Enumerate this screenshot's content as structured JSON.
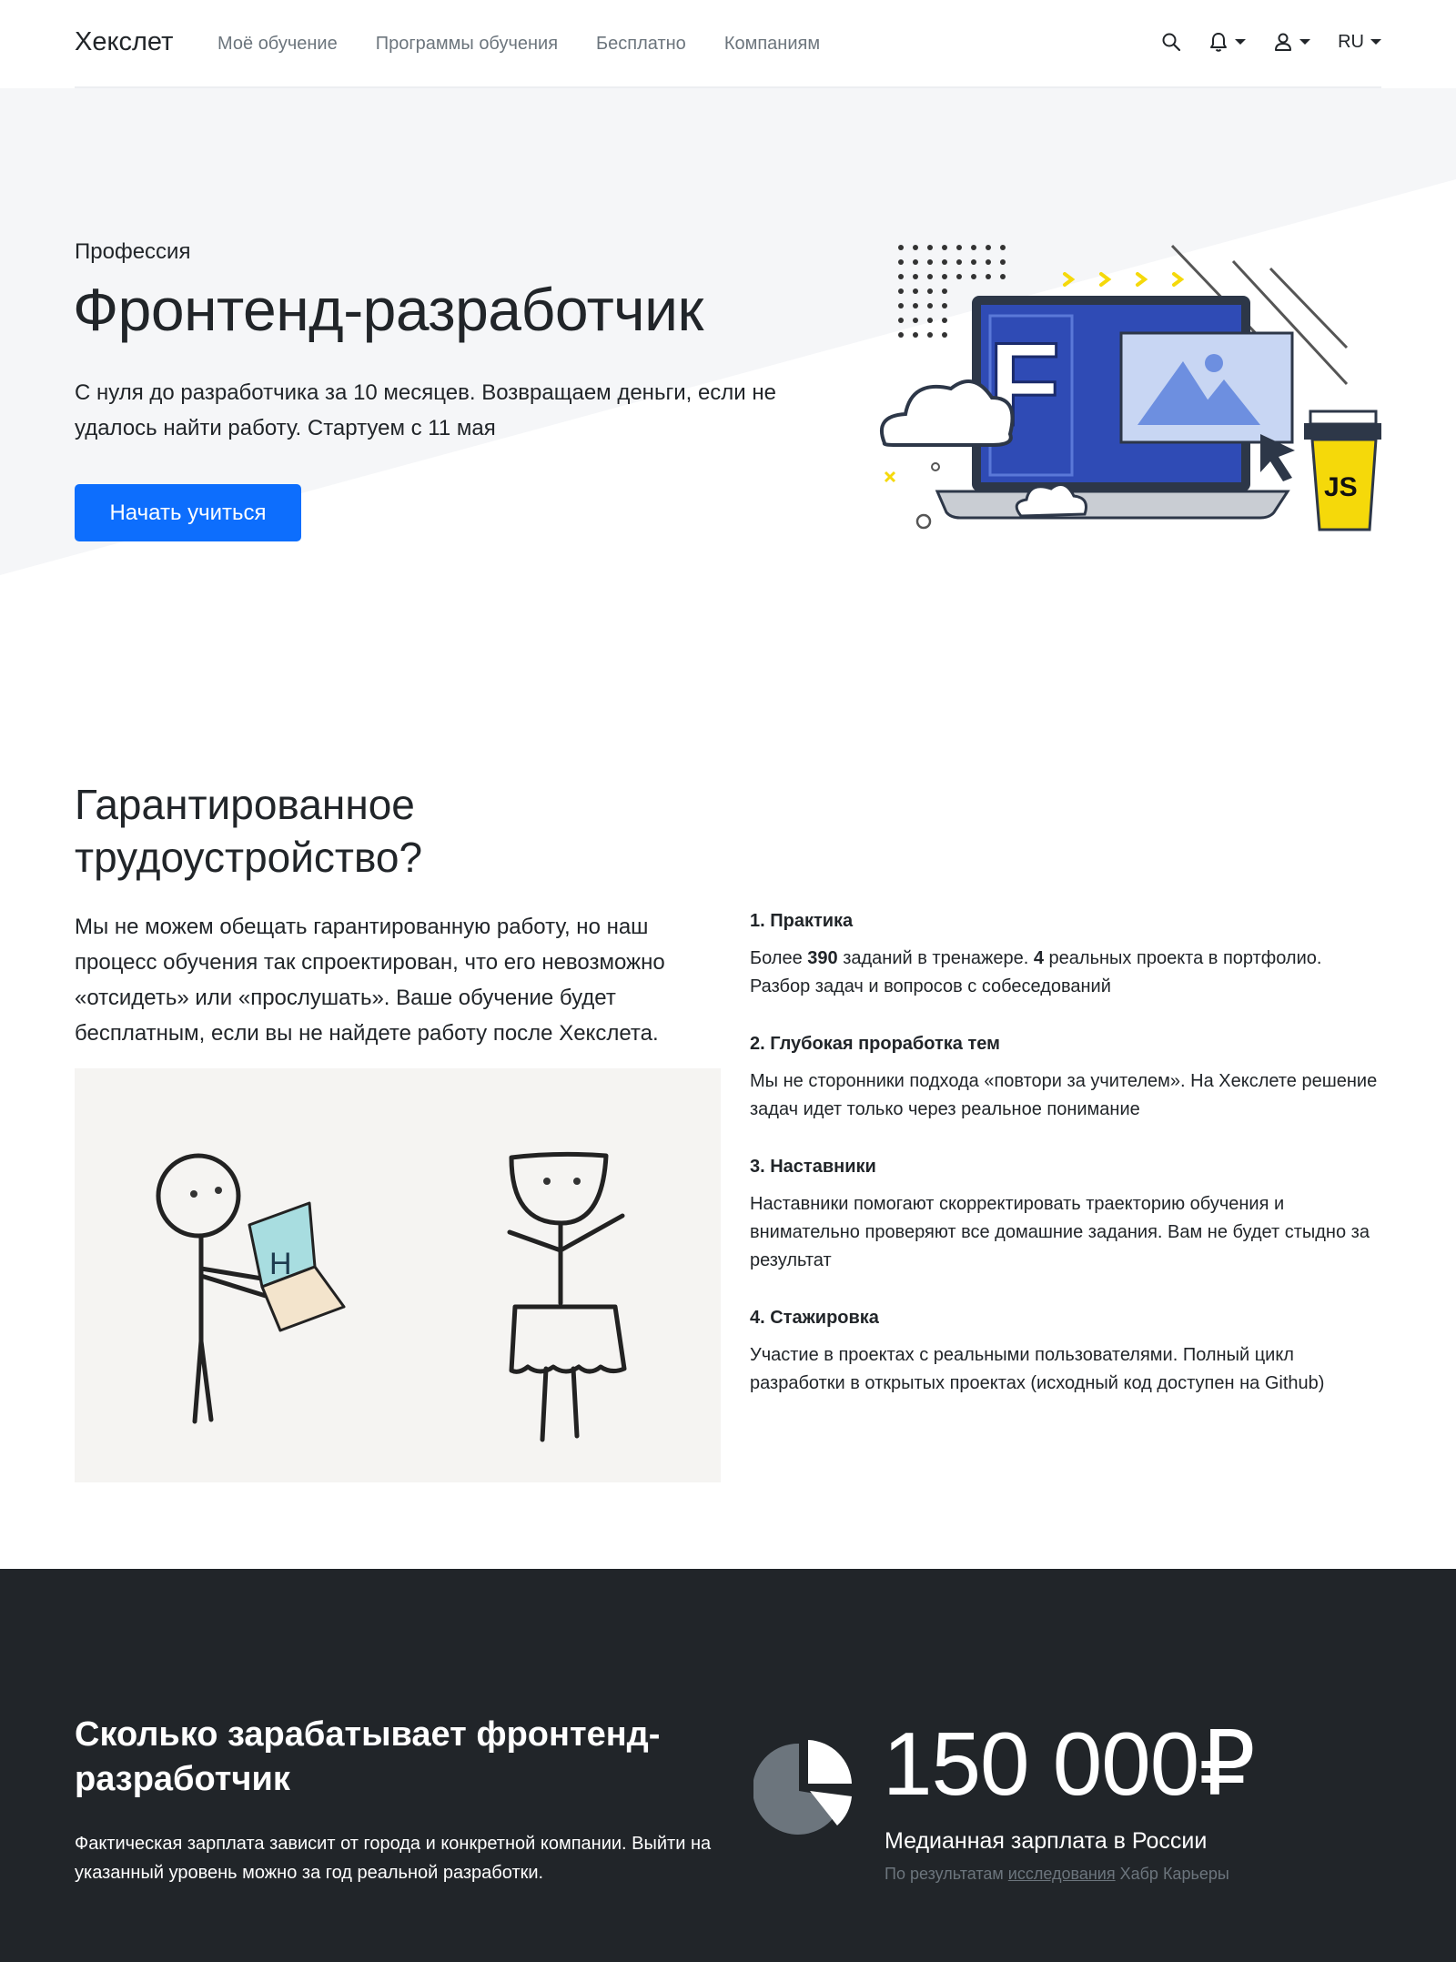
{
  "navbar": {
    "brand": "Хекслет",
    "links": [
      "Моё обучение",
      "Программы обучения",
      "Бесплатно",
      "Компаниям"
    ],
    "language": "RU",
    "icons": [
      "search-icon",
      "bell-icon",
      "user-icon"
    ]
  },
  "hero": {
    "kicker": "Профессия",
    "title": "Фронтенд-разработчик",
    "lead": "С нуля до разработчика за 10 месяцев. Возвращаем деньги, если не удалось найти работу. Стартуем с 11 мая",
    "cta": "Начать учиться",
    "illustration_text": {
      "letter": "F",
      "cup": "JS"
    }
  },
  "guarantee": {
    "title": "Гарантированное трудоустройство?",
    "text": "Мы не можем обещать гарантированную работу, но наш процесс обучения так спроектирован, что его невозможно «отсидеть» или «прослушать». Ваше обучение будет бесплатным, если вы не найдете работу после Хекслета.",
    "laptop_letter": "H",
    "features": [
      {
        "title": "1. Практика",
        "text_parts": [
          "Более ",
          "390",
          " заданий в тренажере. ",
          "4",
          " реальных проекта в портфолио. Разбор задач и вопросов с собеседований"
        ]
      },
      {
        "title": "2. Глубокая проработка тем",
        "text": "Мы не сторонники подхода «повтори за учителем». На Хекслете решение задач идет только через реальное понимание"
      },
      {
        "title": "3. Наставники",
        "text": "Наставники помогают скорректировать траекторию обучения и внимательно проверяют все домашние задания. Вам не будет стыдно за результат"
      },
      {
        "title": "4. Стажировка",
        "text": "Участие в проектах с реальными пользователями. Полный цикл разработки в открытых проектах (исходный код доступен на Github)"
      }
    ]
  },
  "salary": {
    "title": "Сколько зарабатывает фронтенд-разработчик",
    "text": "Фактическая зарплата зависит от города и конкретной компании. Выйти на указанный уровень можно за год реальной разработки.",
    "amount": "150 000₽",
    "caption": "Медианная зарплата в России",
    "source_prefix": "По результатам ",
    "source_link": "исследования",
    "source_suffix": " Хабр Карьеры"
  },
  "colors": {
    "primary": "#0d6efd",
    "dark": "#212529",
    "muted": "#6c757d",
    "hero_bg": "#f5f6f8"
  }
}
